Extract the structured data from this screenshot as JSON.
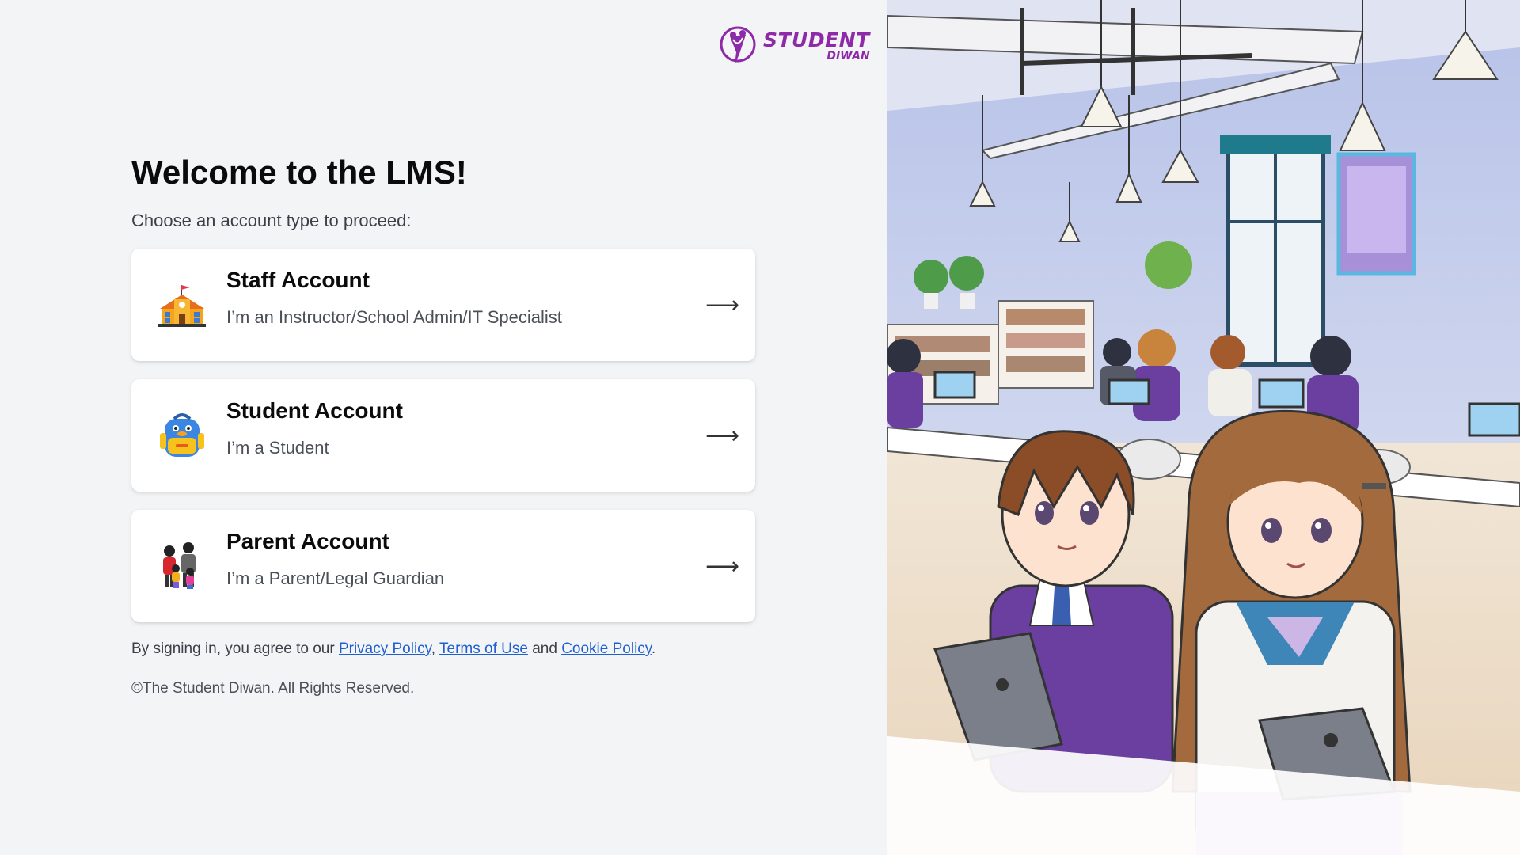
{
  "brand": {
    "line1": "STUDENT",
    "line2": "DIWAN",
    "accent": "#8e2aa8"
  },
  "main": {
    "title": "Welcome to the LMS!",
    "subtitle": "Choose an account type to proceed:"
  },
  "accounts": [
    {
      "name": "Staff Account",
      "description": "I’m an Instructor/School Admin/IT Specialist",
      "icon": "school-building-icon",
      "arrow": "⟶"
    },
    {
      "name": "Student Account",
      "description": "I’m a Student",
      "icon": "backpack-icon",
      "arrow": "⟶"
    },
    {
      "name": "Parent Account",
      "description": "I’m a Parent/Legal Guardian",
      "icon": "family-icon",
      "arrow": "⟶"
    }
  ],
  "footer": {
    "terms_prefix": "By signing in, you agree to our ",
    "privacy": "Privacy Policy",
    "comma": ", ",
    "terms": "Terms of Use",
    "and": " and ",
    "cookie": "Cookie Policy",
    "period": ".",
    "copyright": "©The Student Diwan. All Rights Reserved."
  },
  "colors": {
    "background": "#f3f4f6",
    "card": "#ffffff",
    "link": "#1f5fd0",
    "uniform_purple": "#6b3fa0"
  }
}
